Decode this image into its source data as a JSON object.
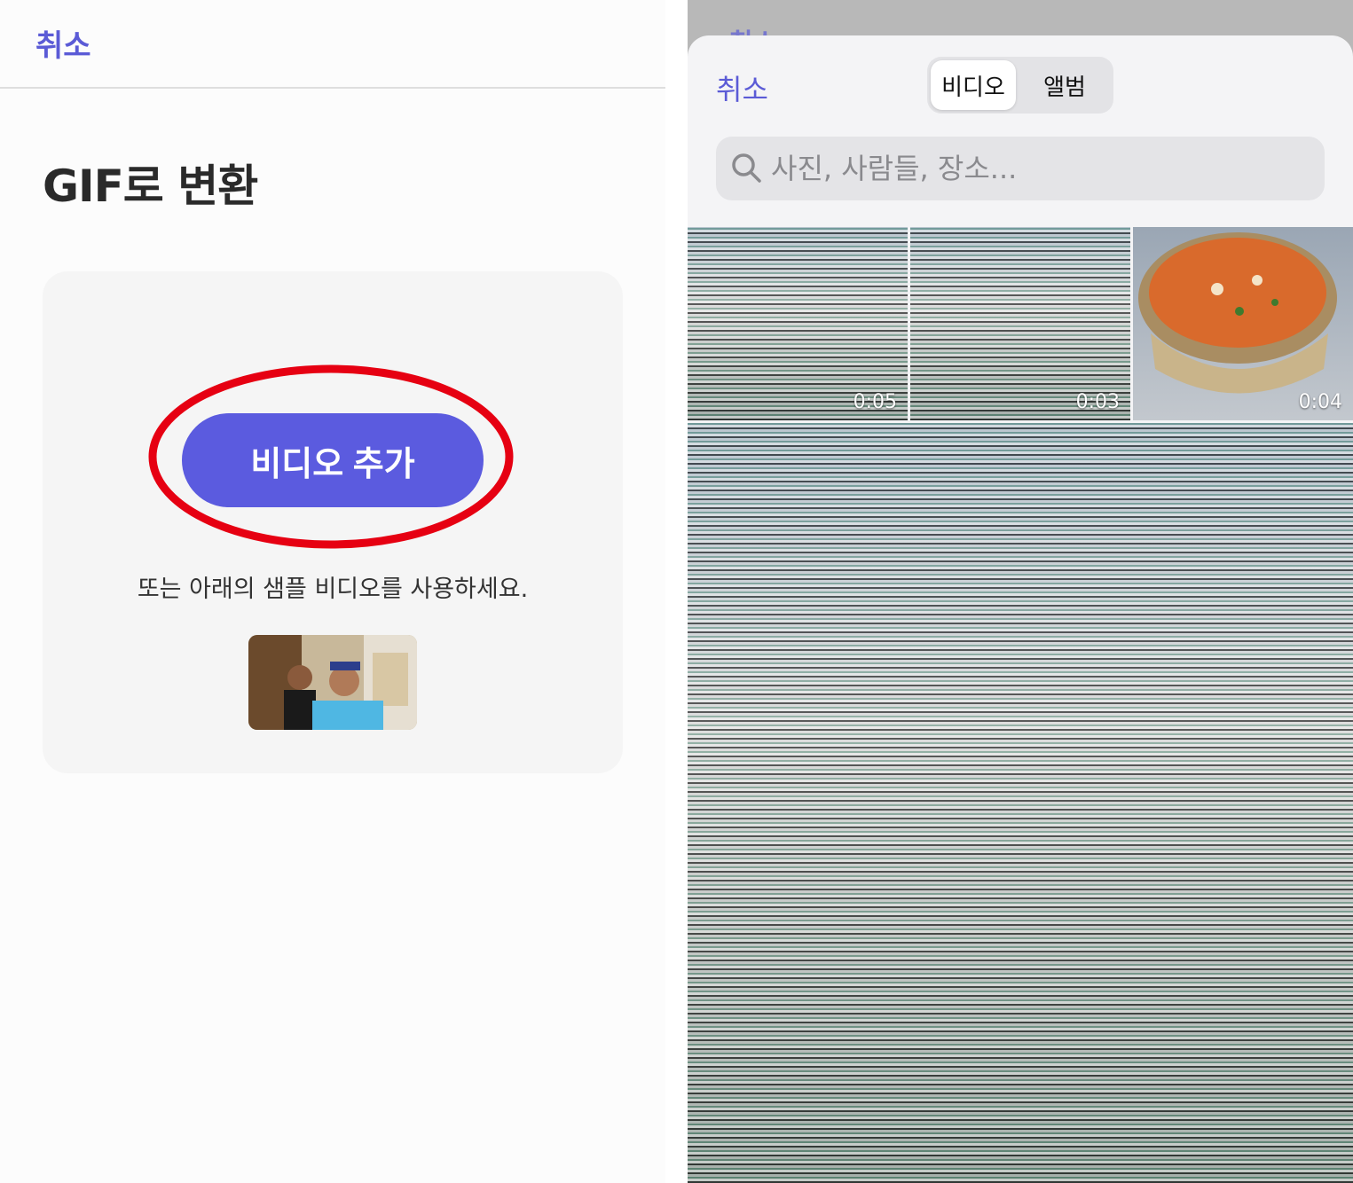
{
  "left": {
    "cancel_label": "취소",
    "title": "GIF로 변환",
    "add_video_label": "비디오 추가",
    "hint_text": "또는 아래의 샘플 비디오를 사용하세요.",
    "accent_color": "#5b5bdf",
    "highlight_color": "#e60012"
  },
  "right": {
    "peek_label": "취소",
    "cancel_label": "취소",
    "segments": [
      {
        "label": "비디오",
        "selected": true
      },
      {
        "label": "앨범",
        "selected": false
      }
    ],
    "search": {
      "placeholder": "사진, 사람들, 장소..."
    },
    "thumbnails": [
      {
        "duration": "0:05"
      },
      {
        "duration": "0:03"
      },
      {
        "duration": "0:04"
      }
    ]
  }
}
